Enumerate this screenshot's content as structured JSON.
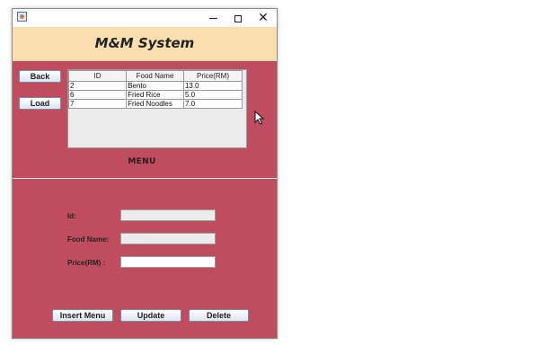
{
  "window": {
    "title": "",
    "controls": {
      "minimize": "minimize",
      "maximize": "maximize",
      "close": "✕"
    }
  },
  "header": {
    "title": "M&M System"
  },
  "buttons": {
    "back": "Back",
    "load": "Load"
  },
  "table": {
    "columns": [
      "ID",
      "Food Name",
      "Price(RM)"
    ],
    "rows": [
      [
        "2",
        "Bento",
        "13.0"
      ],
      [
        "6",
        "Fried Rice",
        "5.0"
      ],
      [
        "7",
        "Fried Noodles",
        "7.0"
      ]
    ]
  },
  "menu_label": "MENU",
  "form": {
    "id_label": "Id:",
    "id_value": "",
    "name_label": "Food Name:",
    "name_value": "",
    "price_label": "Price(RM) :",
    "price_value": ""
  },
  "actions": {
    "insert": "Insert Menu",
    "update": "Update",
    "delete": "Delete"
  },
  "colors": {
    "panel": "#c04c60",
    "header": "#fbdeb0"
  },
  "icons": [
    "java-app-icon",
    "minimize-icon",
    "maximize-icon",
    "close-icon",
    "mouse-cursor-icon"
  ]
}
